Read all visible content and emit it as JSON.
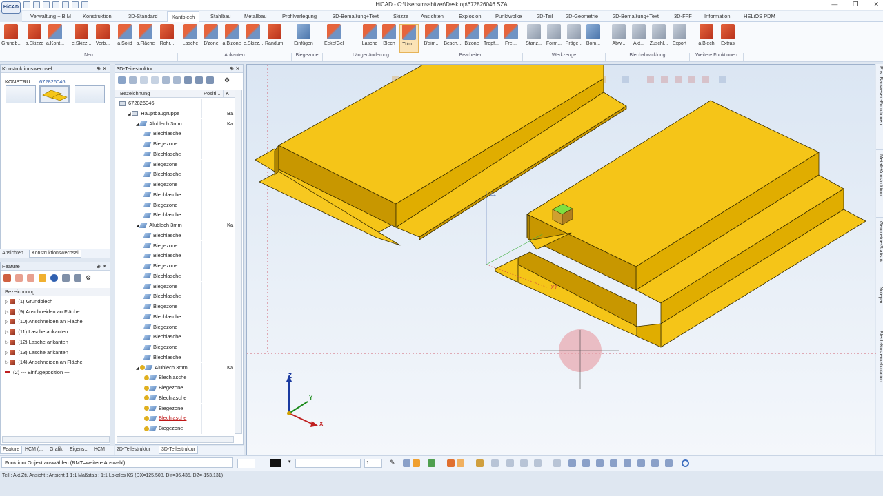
{
  "window": {
    "title": "HiCAD - C:\\Users\\msabitzer\\Desktop\\672826046.SZA",
    "logo": "HiCAD"
  },
  "ribbon_tabs": [
    "Verwaltung + BIM",
    "Konstruktion",
    "3D-Standard",
    "Kantblech",
    "Stahlbau",
    "Metallbau",
    "Profilverlegung",
    "3D-Bemaßung+Text",
    "Skizze",
    "Ansichten",
    "Explosion",
    "Punktwolke",
    "2D-Teil",
    "2D-Geometrie",
    "2D-Bemaßung+Text",
    "3D-FFF",
    "Information",
    "HELiOS PDM"
  ],
  "active_tab": "Kantblech",
  "ribbon_buttons": [
    {
      "label": "Grundb...",
      "icon": "red"
    },
    {
      "label": "a.Skizze",
      "icon": "red"
    },
    {
      "label": "a.Kont...",
      "icon": "mix"
    },
    {
      "label": "e.Skizz...",
      "icon": "red"
    },
    {
      "label": "Verb...",
      "icon": "red"
    },
    {
      "label": "a.Solid",
      "icon": "mix"
    },
    {
      "label": "a.Fläche",
      "icon": "mix"
    },
    {
      "label": "Rohr...",
      "icon": "red"
    },
    {
      "label": "Lasche",
      "icon": "mix"
    },
    {
      "label": "B'zone",
      "icon": "mix"
    },
    {
      "label": "a.B'zone",
      "icon": "mix"
    },
    {
      "label": "e.Skizz...",
      "icon": "mix"
    },
    {
      "label": "Randum...",
      "icon": "red"
    },
    {
      "label": "Einfügen",
      "icon": "blue"
    },
    {
      "label": "Ecke/Gehrung",
      "icon": "mix"
    },
    {
      "label": "Lasche",
      "icon": "mix"
    },
    {
      "label": "Blech",
      "icon": "mix"
    },
    {
      "label": "Trim...",
      "icon": "mix"
    },
    {
      "label": "B'sim...",
      "icon": "mix"
    },
    {
      "label": "Besch...",
      "icon": "mix"
    },
    {
      "label": "B'zone",
      "icon": "mix"
    },
    {
      "label": "Tropf...",
      "icon": "mix"
    },
    {
      "label": "Frei...",
      "icon": "mix"
    },
    {
      "label": "Stanz...",
      "icon": "gray"
    },
    {
      "label": "Form...",
      "icon": "gray"
    },
    {
      "label": "Präge...",
      "icon": "gray"
    },
    {
      "label": "Bom...",
      "icon": "blue"
    },
    {
      "label": "Abw...",
      "icon": "gray"
    },
    {
      "label": "Akt...",
      "icon": "gray"
    },
    {
      "label": "Zuschl...",
      "icon": "gray"
    },
    {
      "label": "Export",
      "icon": "gray"
    },
    {
      "label": "a.Blech",
      "icon": "red"
    },
    {
      "label": "Extras",
      "icon": "red"
    }
  ],
  "ribbon_groups": [
    "Neu",
    "Ankanten",
    "Biegezone",
    "Längenänderung",
    "Bearbeiten",
    "Werkzeuge",
    "Blechabwicklung",
    "Weitere Funktionen"
  ],
  "left_panel": {
    "title": "Konstruktionswechsel",
    "header_left": "KONSTRU...",
    "header_right": "672826046",
    "tabs": [
      "Ansichten",
      "Konstruktionswechsel"
    ]
  },
  "feature_panel": {
    "title": "Feature",
    "column": "Bezeichnung",
    "items": [
      "(1) Grundblech",
      "(9) Anschneiden an Fläche",
      "(10) Anschneiden an Fläche",
      "(11) Lasche ankanten",
      "(12) Lasche ankanten",
      "(13) Lasche ankanten",
      "(14) Anschneiden an Fläche",
      "(2) --- Einfügeposition ---"
    ],
    "tabs": [
      "Feature",
      "HCM (...",
      "Grafik",
      "Eigens...",
      "HCM"
    ]
  },
  "tree_panel": {
    "title": "3D-Teilestruktur",
    "columns": [
      "Bezeichnung",
      "Positi...",
      "K"
    ],
    "rows": [
      {
        "label": "672826046",
        "indent": 0,
        "icon": "asm",
        "pos": "",
        "k": ""
      },
      {
        "label": "Hauptbaugruppe",
        "indent": 1,
        "icon": "asm",
        "pos": "",
        "k": "Ba"
      },
      {
        "label": "Alublech 3mm",
        "indent": 2,
        "icon": "sheet",
        "pos": "",
        "k": "Ka"
      },
      {
        "label": "Blechlasche",
        "indent": 3,
        "icon": "sheet"
      },
      {
        "label": "Biegezone",
        "indent": 3,
        "icon": "sheet"
      },
      {
        "label": "Blechlasche",
        "indent": 3,
        "icon": "sheet"
      },
      {
        "label": "Biegezone",
        "indent": 3,
        "icon": "sheet"
      },
      {
        "label": "Blechlasche",
        "indent": 3,
        "icon": "sheet"
      },
      {
        "label": "Biegezone",
        "indent": 3,
        "icon": "sheet"
      },
      {
        "label": "Blechlasche",
        "indent": 3,
        "icon": "sheet"
      },
      {
        "label": "Biegezone",
        "indent": 3,
        "icon": "sheet"
      },
      {
        "label": "Blechlasche",
        "indent": 3,
        "icon": "sheet"
      },
      {
        "label": "Alublech 3mm",
        "indent": 2,
        "icon": "sheet",
        "k": "Ka"
      },
      {
        "label": "Blechlasche",
        "indent": 3,
        "icon": "sheet"
      },
      {
        "label": "Biegezone",
        "indent": 3,
        "icon": "sheet"
      },
      {
        "label": "Blechlasche",
        "indent": 3,
        "icon": "sheet"
      },
      {
        "label": "Biegezone",
        "indent": 3,
        "icon": "sheet"
      },
      {
        "label": "Blechlasche",
        "indent": 3,
        "icon": "sheet"
      },
      {
        "label": "Biegezone",
        "indent": 3,
        "icon": "sheet"
      },
      {
        "label": "Blechlasche",
        "indent": 3,
        "icon": "sheet"
      },
      {
        "label": "Biegezone",
        "indent": 3,
        "icon": "sheet"
      },
      {
        "label": "Blechlasche",
        "indent": 3,
        "icon": "sheet"
      },
      {
        "label": "Biegezone",
        "indent": 3,
        "icon": "sheet"
      },
      {
        "label": "Blechlasche",
        "indent": 3,
        "icon": "sheet"
      },
      {
        "label": "Biegezone",
        "indent": 3,
        "icon": "sheet"
      },
      {
        "label": "Blechlasche",
        "indent": 3,
        "icon": "sheet"
      },
      {
        "label": "Alublech 3mm",
        "indent": 2,
        "icon": "warn",
        "k": "Ka"
      },
      {
        "label": "Blechlasche",
        "indent": 3,
        "icon": "warn"
      },
      {
        "label": "Biegezone",
        "indent": 3,
        "icon": "warn"
      },
      {
        "label": "Blechlasche",
        "indent": 3,
        "icon": "warn"
      },
      {
        "label": "Biegezone",
        "indent": 3,
        "icon": "warn"
      },
      {
        "label": "Blechlasche",
        "indent": 3,
        "icon": "warn",
        "highlight": true
      },
      {
        "label": "Biegezone",
        "indent": 3,
        "icon": "warn"
      }
    ],
    "tabs": [
      "2D-Teilestruktur",
      "3D-Teilestruktur"
    ]
  },
  "viewport": {
    "axis_labels": {
      "z1": "Z1",
      "x1": "X1",
      "z": "Z",
      "y": "Y",
      "x": "X"
    },
    "sheet_color": "#f5c518"
  },
  "right_tabs": [
    "Erw. Bauwesen-Funktionen",
    "Metall-Konstruktion",
    "Geometrie-Statistik",
    "Notepad",
    "Blech-Kostenkalkulation"
  ],
  "command_prompt": "Funktion/ Objekt auswählen (RMT=weitere Auswahl)",
  "line_width": "1",
  "status_bar": "Teil : Akt.Zti.   Ansicht : Ansicht 1 1:1   Maßstab : 1:1   Lokales KS (DX=125.508, DY=36.435, DZ=-153.131)"
}
